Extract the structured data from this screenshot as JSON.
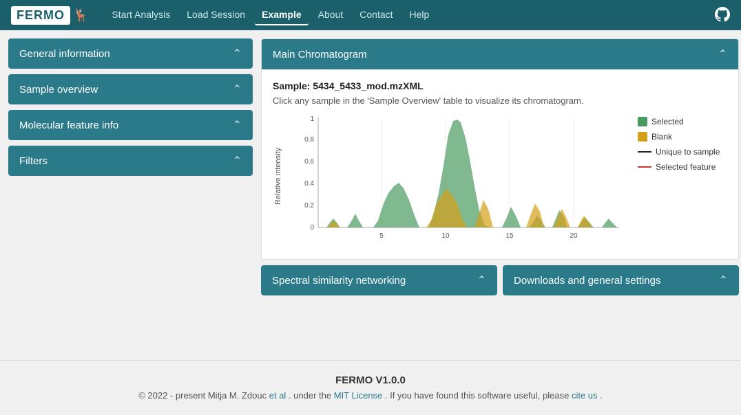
{
  "navbar": {
    "logo": "FERMO",
    "links": [
      {
        "label": "Start Analysis",
        "active": false
      },
      {
        "label": "Load Session",
        "active": false
      },
      {
        "label": "Example",
        "active": true
      },
      {
        "label": "About",
        "active": false
      },
      {
        "label": "Contact",
        "active": false
      },
      {
        "label": "Help",
        "active": false
      }
    ],
    "github_icon": "github"
  },
  "sidebar": {
    "sections": [
      {
        "title": "General information"
      },
      {
        "title": "Sample overview"
      },
      {
        "title": "Molecular feature info"
      },
      {
        "title": "Filters"
      }
    ]
  },
  "main_panel": {
    "title": "Main Chromatogram",
    "sample_label": "Sample:",
    "sample_name": "5434_5433_mod.mzXML",
    "subtitle": "Click any sample in the 'Sample Overview' table to visualize its chromatogram.",
    "x_axis": {
      "label": "",
      "ticks": [
        "5",
        "10",
        "15",
        "20"
      ]
    },
    "y_axis": {
      "label": "Relative intensity",
      "ticks": [
        "0",
        "0.2",
        "0.4",
        "0.6",
        "0.8",
        "1"
      ]
    },
    "legend": [
      {
        "type": "box",
        "color": "#4a9a60",
        "label": "Selected"
      },
      {
        "type": "box",
        "color": "#d4a017",
        "label": "Blank"
      },
      {
        "type": "line",
        "color": "#222222",
        "label": "Unique to sample"
      },
      {
        "type": "line",
        "color": "#cc3333",
        "label": "Selected feature"
      }
    ]
  },
  "bottom_panels": [
    {
      "title": "Spectral similarity networking"
    },
    {
      "title": "Downloads and general settings"
    }
  ],
  "footer": {
    "title": "FERMO V1.0.0",
    "copyright": "© 2022 - present Mitja M. Zdouc",
    "et_al": "et al",
    "under": ". under the",
    "mit_label": "MIT License",
    "helpful": ". If you have found this software useful, please",
    "cite": "cite us",
    "period": "."
  }
}
